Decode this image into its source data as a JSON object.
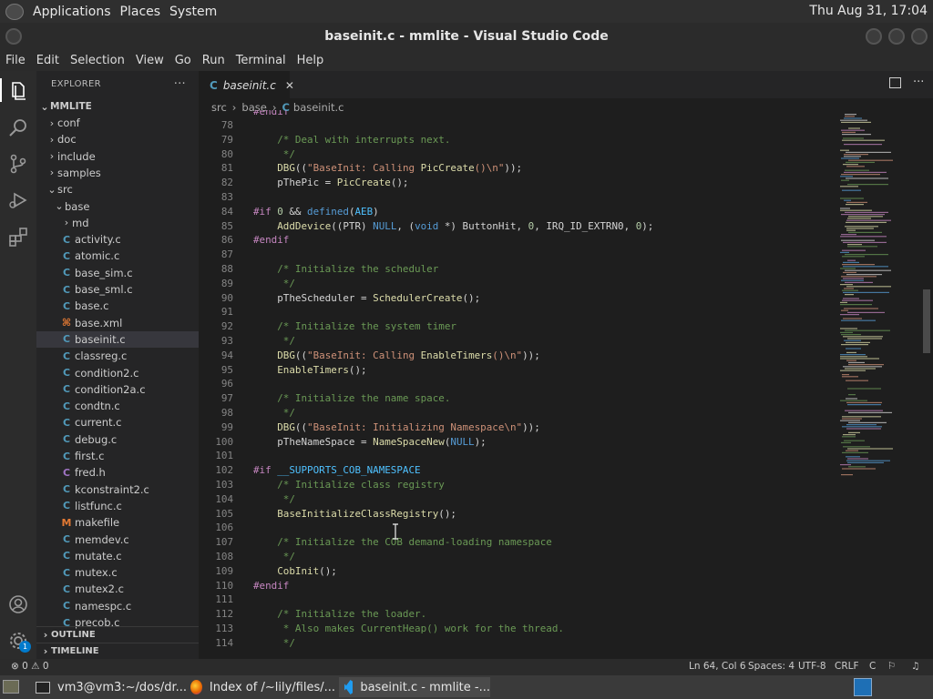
{
  "system_bar": {
    "menus": [
      "Applications",
      "Places",
      "System"
    ],
    "clock": "Thu Aug 31, 17:04"
  },
  "window": {
    "title": "baseinit.c - mmlite - Visual Studio Code"
  },
  "menubar": [
    "File",
    "Edit",
    "Selection",
    "View",
    "Go",
    "Run",
    "Terminal",
    "Help"
  ],
  "explorer": {
    "header": "EXPLORER",
    "more": "···",
    "root": "MMLITE",
    "items": [
      {
        "label": "conf",
        "kind": "folder"
      },
      {
        "label": "doc",
        "kind": "folder"
      },
      {
        "label": "include",
        "kind": "folder"
      },
      {
        "label": "samples",
        "kind": "folder"
      },
      {
        "label": "src",
        "kind": "folder-open"
      },
      {
        "label": "base",
        "kind": "folder-open"
      },
      {
        "label": "md",
        "kind": "folder"
      },
      {
        "label": "activity.c",
        "kind": "c"
      },
      {
        "label": "atomic.c",
        "kind": "c"
      },
      {
        "label": "base_sim.c",
        "kind": "c"
      },
      {
        "label": "base_sml.c",
        "kind": "c"
      },
      {
        "label": "base.c",
        "kind": "c"
      },
      {
        "label": "base.xml",
        "kind": "xml"
      },
      {
        "label": "baseinit.c",
        "kind": "c"
      },
      {
        "label": "classreg.c",
        "kind": "c"
      },
      {
        "label": "condition2.c",
        "kind": "c"
      },
      {
        "label": "condition2a.c",
        "kind": "c"
      },
      {
        "label": "condtn.c",
        "kind": "c"
      },
      {
        "label": "current.c",
        "kind": "c"
      },
      {
        "label": "debug.c",
        "kind": "c"
      },
      {
        "label": "first.c",
        "kind": "c"
      },
      {
        "label": "fred.h",
        "kind": "h"
      },
      {
        "label": "kconstraint2.c",
        "kind": "c"
      },
      {
        "label": "listfunc.c",
        "kind": "c"
      },
      {
        "label": "makefile",
        "kind": "m"
      },
      {
        "label": "memdev.c",
        "kind": "c"
      },
      {
        "label": "mutate.c",
        "kind": "c"
      },
      {
        "label": "mutex.c",
        "kind": "c"
      },
      {
        "label": "mutex2.c",
        "kind": "c"
      },
      {
        "label": "namespc.c",
        "kind": "c"
      },
      {
        "label": "precob.c",
        "kind": "c"
      }
    ],
    "selected": "baseinit.c",
    "outline": "OUTLINE",
    "timeline": "TIMELINE"
  },
  "tab": {
    "icon": "C",
    "label": "baseinit.c",
    "close": "✕"
  },
  "breadcrumb": [
    "src",
    "base",
    "baseinit.c"
  ],
  "code": {
    "partial_top": "#endif",
    "lines": [
      {
        "n": 78,
        "t": ""
      },
      {
        "n": 79,
        "t": "    /* Deal with interrupts next."
      },
      {
        "n": 80,
        "t": "     */"
      },
      {
        "n": 81,
        "t": "    DBG((\"BaseInit: Calling PicCreate()\\n\"));"
      },
      {
        "n": 82,
        "t": "    pThePic = PicCreate();"
      },
      {
        "n": 83,
        "t": ""
      },
      {
        "n": 84,
        "t": "#if 0 && defined(AEB)"
      },
      {
        "n": 85,
        "t": "    AddDevice((PTR) NULL, (void *) ButtonHit, 0, IRQ_ID_EXTRN0, 0);"
      },
      {
        "n": 86,
        "t": "#endif"
      },
      {
        "n": 87,
        "t": ""
      },
      {
        "n": 88,
        "t": "    /* Initialize the scheduler"
      },
      {
        "n": 89,
        "t": "     */"
      },
      {
        "n": 90,
        "t": "    pTheScheduler = SchedulerCreate();"
      },
      {
        "n": 91,
        "t": ""
      },
      {
        "n": 92,
        "t": "    /* Initialize the system timer"
      },
      {
        "n": 93,
        "t": "     */"
      },
      {
        "n": 94,
        "t": "    DBG((\"BaseInit: Calling EnableTimers()\\n\"));"
      },
      {
        "n": 95,
        "t": "    EnableTimers();"
      },
      {
        "n": 96,
        "t": ""
      },
      {
        "n": 97,
        "t": "    /* Initialize the name space."
      },
      {
        "n": 98,
        "t": "     */"
      },
      {
        "n": 99,
        "t": "    DBG((\"BaseInit: Initializing Namespace\\n\"));"
      },
      {
        "n": 100,
        "t": "    pTheNameSpace = NameSpaceNew(NULL);"
      },
      {
        "n": 101,
        "t": ""
      },
      {
        "n": 102,
        "t": "#if __SUPPORTS_COB_NAMESPACE"
      },
      {
        "n": 103,
        "t": "    /* Initialize class registry"
      },
      {
        "n": 104,
        "t": "     */"
      },
      {
        "n": 105,
        "t": "    BaseInitializeClassRegistry();"
      },
      {
        "n": 106,
        "t": ""
      },
      {
        "n": 107,
        "t": "    /* Initialize the COB demand-loading namespace"
      },
      {
        "n": 108,
        "t": "     */"
      },
      {
        "n": 109,
        "t": "    CobInit();"
      },
      {
        "n": 110,
        "t": "#endif"
      },
      {
        "n": 111,
        "t": ""
      },
      {
        "n": 112,
        "t": "    /* Initialize the loader."
      },
      {
        "n": 113,
        "t": "     * Also makes CurrentHeap() work for the thread."
      },
      {
        "n": 114,
        "t": "     */"
      }
    ]
  },
  "status": {
    "problems": "⊗ 0 ⚠ 0",
    "position": "Ln 64, Col 6",
    "spaces": "Spaces: 4",
    "encoding": "UTF-8",
    "eol": "CRLF",
    "language": "C"
  },
  "taskbar": [
    {
      "label": "vm3@vm3:~/dos/dr..."
    },
    {
      "label": "Index of /~lily/files/..."
    },
    {
      "label": "baseinit.c - mmlite -..."
    }
  ],
  "account_badge": "1",
  "colors": {
    "accent": "#007acc",
    "c_icon": "#519aba",
    "xml_icon": "#e37933",
    "makefile_icon": "#e37933",
    "h_icon": "#a074c4",
    "comment": "#6a9955",
    "preproc": "#c586c0"
  }
}
